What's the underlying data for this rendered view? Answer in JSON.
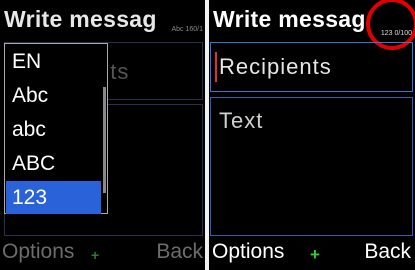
{
  "left": {
    "title": "Write messag",
    "mode_indicator": "Abc 160/1",
    "recipients_placeholder": "nts",
    "dropdown": {
      "items": [
        "EN",
        "Abc",
        "abc",
        "ABC",
        "123"
      ],
      "selected": "123"
    },
    "softkeys": {
      "options": "Options",
      "back": "Back"
    }
  },
  "right": {
    "title": "Write messag",
    "mode_indicator": "123 0/100",
    "recipients_placeholder": "Recipients",
    "text_placeholder": "Text",
    "softkeys": {
      "options": "Options",
      "back": "Back"
    }
  },
  "colors": {
    "accent_blue": "#2a63d9",
    "highlight_red": "#e00000",
    "plus_green": "#2fd02f"
  }
}
